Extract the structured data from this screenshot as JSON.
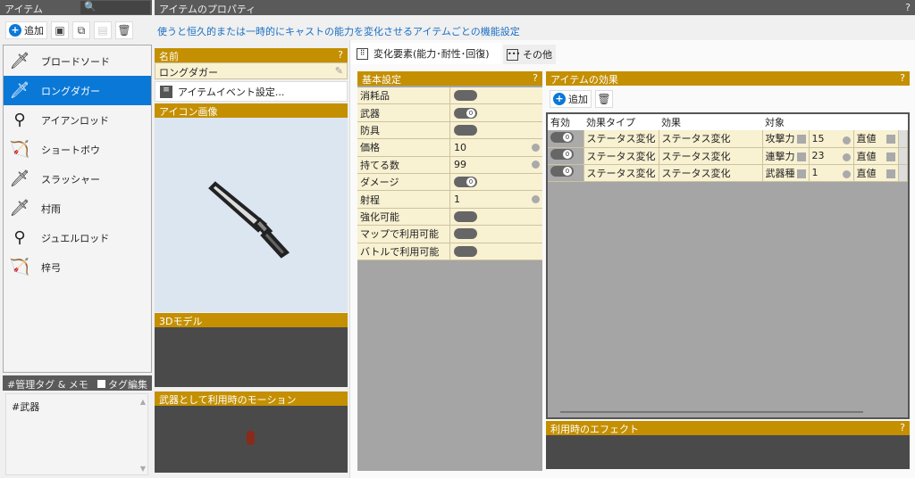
{
  "left": {
    "title": "アイテム",
    "add": "追加",
    "items": [
      {
        "name": "ブロードソード",
        "icon": "sword-icon",
        "g": "🗡"
      },
      {
        "name": "ロングダガー",
        "icon": "dagger-icon",
        "g": "🗡",
        "selected": true
      },
      {
        "name": "アイアンロッド",
        "icon": "rod-icon",
        "g": "⚲"
      },
      {
        "name": "ショートボウ",
        "icon": "bow-icon",
        "g": "🏹"
      },
      {
        "name": "スラッシャー",
        "icon": "slasher-icon",
        "g": "🗡"
      },
      {
        "name": "村雨",
        "icon": "katana-icon",
        "g": "🗡"
      },
      {
        "name": "ジュエルロッド",
        "icon": "jewel-rod-icon",
        "g": "⚲"
      },
      {
        "name": "梓弓",
        "icon": "bow-icon",
        "g": "🏹"
      }
    ],
    "tag_title": "#管理タグ & メモ",
    "tag_edit": "タグ編集",
    "memo": "#武器"
  },
  "props": {
    "title": "アイテムのプロパティ",
    "help": "?",
    "description": "使うと恒久的または一時的にキャストの能力を変化させるアイテムごとの機能設定",
    "name_label": "名前",
    "name_value": "ロングダガー",
    "event_button": "アイテムイベント設定...",
    "icon_label": "アイコン画像",
    "model_label": "3Dモデル",
    "motion_label": "武器として利用時のモーション"
  },
  "tabs": [
    {
      "label": "変化要素(能力･耐性･回復)"
    },
    {
      "label": "その他"
    }
  ],
  "basic": {
    "title": "基本設定",
    "rows": [
      {
        "label": "消耗品",
        "type": "toggle",
        "on": false
      },
      {
        "label": "武器",
        "type": "toggle",
        "on": true
      },
      {
        "label": "防具",
        "type": "toggle",
        "on": false
      },
      {
        "label": "価格",
        "type": "num",
        "value": "10"
      },
      {
        "label": "持てる数",
        "type": "num",
        "value": "99"
      },
      {
        "label": "ダメージ",
        "type": "toggle",
        "on": true
      },
      {
        "label": "射程",
        "type": "num",
        "value": "1"
      },
      {
        "label": "強化可能",
        "type": "toggle",
        "on": false
      },
      {
        "label": "マップで利用可能",
        "type": "toggle",
        "on": false
      },
      {
        "label": "バトルで利用可能",
        "type": "toggle",
        "on": false
      }
    ]
  },
  "effects": {
    "title": "アイテムの効果",
    "add": "追加",
    "headers": [
      "有効",
      "効果タイプ",
      "効果",
      "対象",
      "",
      ""
    ],
    "rows": [
      {
        "type": "ステータス変化",
        "effect": "ステータス変化",
        "target": "攻撃力",
        "value": "15",
        "mode": "直値"
      },
      {
        "type": "ステータス変化",
        "effect": "ステータス変化",
        "target": "連撃力",
        "value": "23",
        "mode": "直値"
      },
      {
        "type": "ステータス変化",
        "effect": "ステータス変化",
        "target": "武器種",
        "value": "1",
        "mode": "直値"
      }
    ],
    "use_effect": "利用時のエフェクト"
  }
}
